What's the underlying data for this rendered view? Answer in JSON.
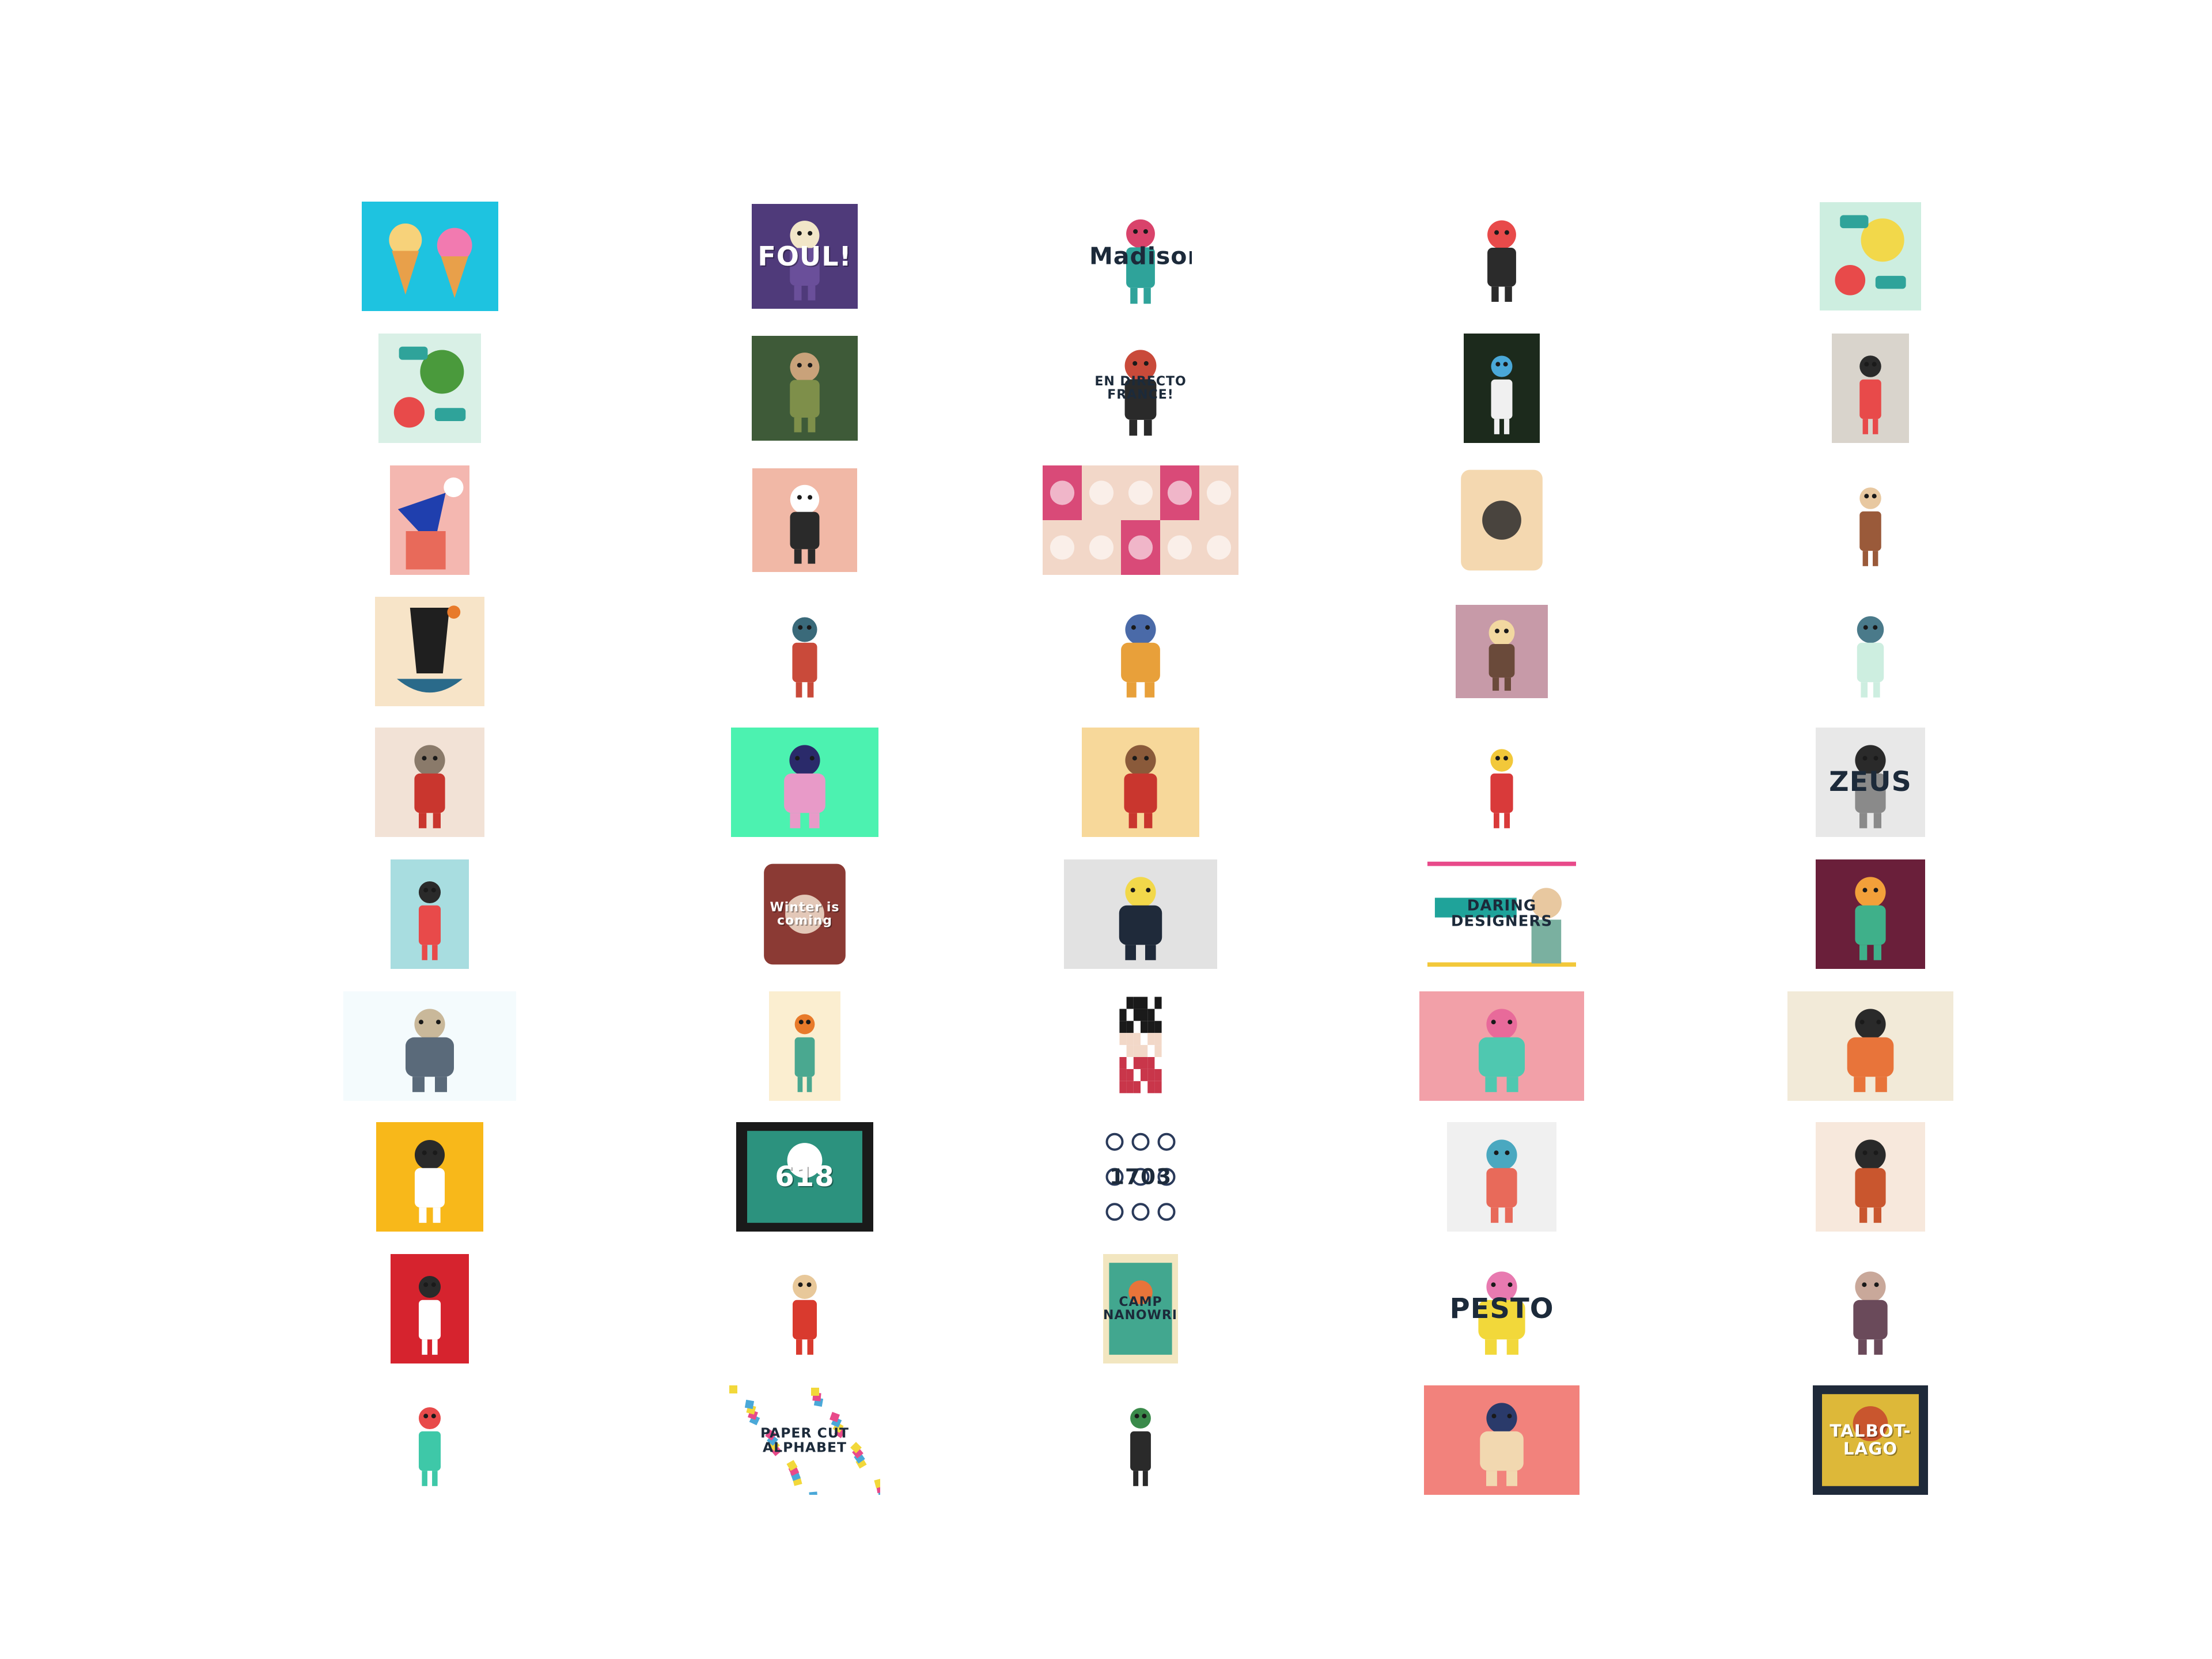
{
  "page": {
    "background": "#ffffff"
  },
  "gallery": {
    "items": [
      {
        "label": "",
        "colors": [
          "#ec4fb9",
          "#1ec3e0",
          "#f7a13d"
        ],
        "motif": "ice-cream"
      },
      {
        "label": "FOUL!",
        "colors": [
          "#4f3a7a",
          "#6a4f9a",
          "#f2e6c8"
        ],
        "motif": "character"
      },
      {
        "label": "Madison",
        "colors": [
          "#ffffff",
          "#2fa39a",
          "#d9436b"
        ],
        "motif": "character"
      },
      {
        "label": "",
        "colors": [
          "#ffffff",
          "#2b2b2b",
          "#e84a4a"
        ],
        "motif": "figure"
      },
      {
        "label": "",
        "colors": [
          "#cdeee0",
          "#f2d84a",
          "#e84a4a"
        ],
        "motif": "fruit"
      },
      {
        "label": "",
        "colors": [
          "#d9f0e6",
          "#4a9a3c",
          "#e84a4a"
        ],
        "motif": "fruit"
      },
      {
        "label": "",
        "colors": [
          "#3e5a38",
          "#7e8f4a",
          "#c9a27a"
        ],
        "motif": "character"
      },
      {
        "label": "EN DIRECTO FRANCE!",
        "colors": [
          "#ffffff",
          "#2a2a2a",
          "#c94a3a"
        ],
        "motif": "figure"
      },
      {
        "label": "",
        "colors": [
          "#1c2a1c",
          "#f0f0f0",
          "#4aa8d8"
        ],
        "motif": "character"
      },
      {
        "label": "",
        "colors": [
          "#d9d4cc",
          "#e84a4a",
          "#2a2a2a"
        ],
        "motif": "letters"
      },
      {
        "label": "",
        "colors": [
          "#f4b7b0",
          "#1f3fae",
          "#ffffff"
        ],
        "motif": "flamingo"
      },
      {
        "label": "",
        "colors": [
          "#f1b8a6",
          "#2a2a2a",
          "#ffffff"
        ],
        "motif": "camera"
      },
      {
        "label": "",
        "colors": [
          "#2fb0a0",
          "#d94a78",
          "#f2d7c8"
        ],
        "motif": "grid"
      },
      {
        "label": "",
        "colors": [
          "#8b3a3a",
          "#f4d8b0",
          "#2a2a2a"
        ],
        "motif": "badge"
      },
      {
        "label": "",
        "colors": [
          "#ffffff",
          "#9a5a3a",
          "#e8c8a0"
        ],
        "motif": "figure"
      },
      {
        "label": "",
        "colors": [
          "#f7e4c8",
          "#1f1f1f",
          "#e87a2a"
        ],
        "motif": "fox"
      },
      {
        "label": "",
        "colors": [
          "#ffffff",
          "#c94a3a",
          "#3a6a7a"
        ],
        "motif": "figure"
      },
      {
        "label": "",
        "colors": [
          "#ffffff",
          "#e8a03a",
          "#4a6aa8"
        ],
        "motif": "dancers"
      },
      {
        "label": "",
        "colors": [
          "#c79aa8",
          "#6a4a3a",
          "#f2d8a0"
        ],
        "motif": "building"
      },
      {
        "label": "",
        "colors": [
          "#ffffff",
          "#cdeee0",
          "#4a7a8a"
        ],
        "motif": "egg"
      },
      {
        "label": "",
        "colors": [
          "#f2e2d6",
          "#c9362e",
          "#8a7a6a"
        ],
        "motif": "bird"
      },
      {
        "label": "",
        "colors": [
          "#4cf2b0",
          "#e89ac8",
          "#2a2a6a"
        ],
        "motif": "character"
      },
      {
        "label": "",
        "colors": [
          "#f7d89a",
          "#c9362e",
          "#8a5a3a"
        ],
        "motif": "character"
      },
      {
        "label": "",
        "colors": [
          "#ffffff",
          "#d93a3a",
          "#f2c83a"
        ],
        "motif": "king"
      },
      {
        "label": "ZEUS",
        "colors": [
          "#e8e8e8",
          "#8a8a8a",
          "#2a2a2a"
        ],
        "motif": "character"
      },
      {
        "label": "",
        "colors": [
          "#a8dde0",
          "#e84a4a",
          "#2a2a2a"
        ],
        "motif": "cow"
      },
      {
        "label": "Winter is coming",
        "colors": [
          "#ffffff",
          "#8b3a34",
          "#f2e2d0"
        ],
        "motif": "badge"
      },
      {
        "label": "",
        "colors": [
          "#e2e2e2",
          "#1f2a3a",
          "#f2d84a"
        ],
        "motif": "stationery"
      },
      {
        "label": "DARING DESIGNERS",
        "colors": [
          "#ffffff",
          "#1fa39a",
          "#2a2a2a"
        ],
        "motif": "banner"
      },
      {
        "label": "",
        "colors": [
          "#6a1f3a",
          "#3fb08a",
          "#f2a03a"
        ],
        "motif": "character"
      },
      {
        "label": "",
        "colors": [
          "#f4fbfd",
          "#5a6a7a",
          "#c9b89a"
        ],
        "motif": "logo"
      },
      {
        "label": "",
        "colors": [
          "#fbeed0",
          "#4aa890",
          "#e87a2a"
        ],
        "motif": "turtle"
      },
      {
        "label": "",
        "colors": [
          "#ffffff",
          "#1a1a1a",
          "#c9364a"
        ],
        "motif": "pixel"
      },
      {
        "label": "",
        "colors": [
          "#f2a0a8",
          "#4fc8b0",
          "#e86a9a"
        ],
        "motif": "pigs"
      },
      {
        "label": "",
        "colors": [
          "#f2ead8",
          "#e8743a",
          "#2a2a2a"
        ],
        "motif": "fox-face"
      },
      {
        "label": "",
        "colors": [
          "#f8b81a",
          "#ffffff",
          "#2a2a2a"
        ],
        "motif": "stamp"
      },
      {
        "label": "618",
        "colors": [
          "#1a1a1a",
          "#2fa08a",
          "#ffffff"
        ],
        "motif": "poster"
      },
      {
        "label": "1703",
        "colors": [
          "#ffffff",
          "#2a3a5a",
          "#c9362e"
        ],
        "motif": "icons"
      },
      {
        "label": "",
        "colors": [
          "#f0f0f0",
          "#e86a5a",
          "#4aa8c0"
        ],
        "motif": "figure"
      },
      {
        "label": "",
        "colors": [
          "#f7e8dc",
          "#c9562e",
          "#2a2a2a"
        ],
        "motif": "bird"
      },
      {
        "label": "",
        "colors": [
          "#d6232e",
          "#ffffff",
          "#2a2a2a"
        ],
        "motif": "footballer"
      },
      {
        "label": "",
        "colors": [
          "#ffffff",
          "#d93a2e",
          "#e8c89a"
        ],
        "motif": "basketball"
      },
      {
        "label": "CAMP NANOWRIMO",
        "colors": [
          "#f2e6c0",
          "#2fa08a",
          "#e8743a"
        ],
        "motif": "poster"
      },
      {
        "label": "PESTO",
        "colors": [
          "#ffffff",
          "#f2d83a",
          "#e87ab0"
        ],
        "motif": "mascot"
      },
      {
        "label": "",
        "colors": [
          "#ffffff",
          "#6a4a5a",
          "#c9a89a"
        ],
        "motif": "mice"
      },
      {
        "label": "",
        "colors": [
          "#ffffff",
          "#3ec8a8",
          "#e84a4a"
        ],
        "motif": "croc"
      },
      {
        "label": "PAPER CUT ALPHABET",
        "colors": [
          "#ffffff",
          "#f2d83a",
          "#4aa8d8"
        ],
        "motif": "confetti"
      },
      {
        "label": "",
        "colors": [
          "#ffffff",
          "#2a2a2a",
          "#3a8a4a"
        ],
        "motif": "character"
      },
      {
        "label": "",
        "colors": [
          "#f2827c",
          "#f2d8b0",
          "#2a3a6a"
        ],
        "motif": "face"
      },
      {
        "label": "TALBOT-LAGO",
        "colors": [
          "#1f2a3a",
          "#f2c83a",
          "#c9562e"
        ],
        "motif": "poster"
      }
    ]
  }
}
